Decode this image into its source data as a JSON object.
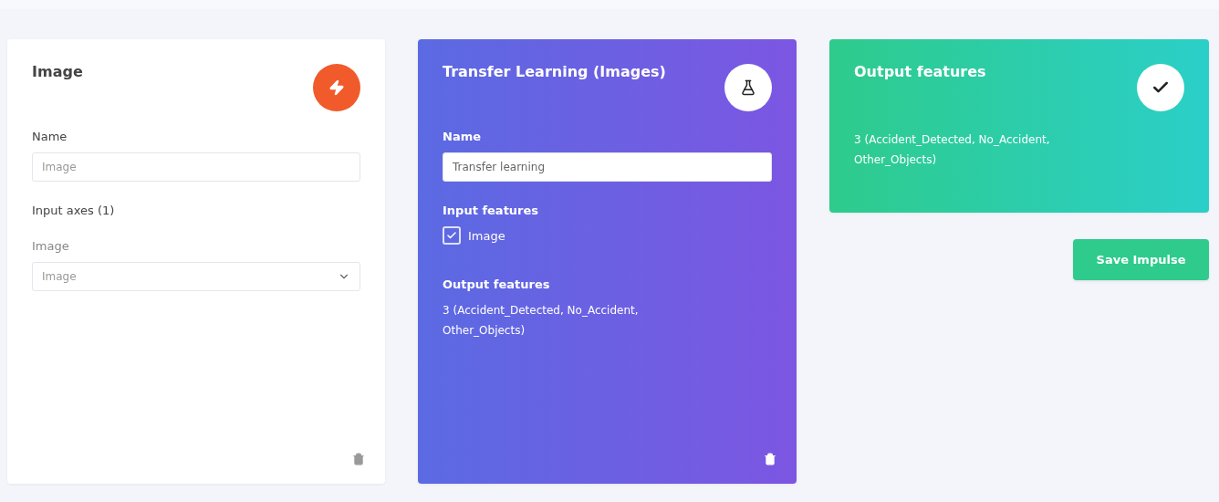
{
  "input_block": {
    "title": "Image",
    "name_label": "Name",
    "name_value": "Image",
    "axes_label": "Input axes (1)",
    "axis_label": "Image",
    "axis_value": "Image"
  },
  "learning_block": {
    "title": "Transfer Learning (Images)",
    "name_label": "Name",
    "name_value": "Transfer learning",
    "input_label": "Input features",
    "inputs": [
      {
        "label": "Image",
        "checked": true
      }
    ],
    "output_label": "Output features",
    "output_text": "3 (Accident_Detected, No_Accident, Other_Objects)"
  },
  "output_block": {
    "title": "Output features",
    "text": "3 (Accident_Detected, No_Accident, Other_Objects)"
  },
  "save_button": "Save Impulse"
}
